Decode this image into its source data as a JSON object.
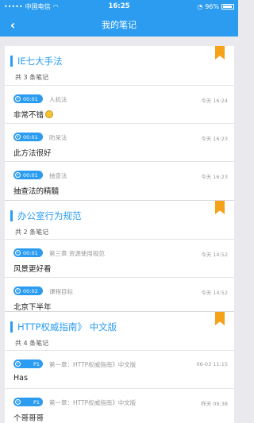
{
  "status": {
    "carrier": "中国电信",
    "time": "16:25",
    "battery": "96%"
  },
  "nav": {
    "back_icon": "chevron-left-icon",
    "title": "我的笔记"
  },
  "groups": [
    {
      "title": "IE七大手法",
      "count": "共 3 条笔记",
      "notes": [
        {
          "badge": "00:01",
          "source": "人机法",
          "time": "今天 16:24",
          "text": "非常不错"
        },
        {
          "badge": "00:01",
          "source": "防呆法",
          "time": "今天 16:23",
          "text": "此方法很好"
        },
        {
          "badge": "00:01",
          "source": "抽查法",
          "time": "今天 16:23",
          "text": "抽查法的精髓"
        }
      ]
    },
    {
      "title": "办公室行为规范",
      "count": "共 2 条笔记",
      "notes": [
        {
          "badge": "00:01",
          "source": "第三章 资源使用规范",
          "time": "今天 14:52",
          "text": "风景更好看"
        },
        {
          "badge": "00:02",
          "source": "课程目标",
          "time": "今天 14:52",
          "text": "北京下半年"
        }
      ]
    },
    {
      "title": "HTTP权威指南》 中文版",
      "count": "共 4 条笔记",
      "notes": [
        {
          "badge": "P1",
          "source": "第一章：HTTP权威指南》中文版",
          "time": "06-03 11:15",
          "text": "Has"
        },
        {
          "badge": "P1",
          "source": "第一章：HTTP权威指南》中文版",
          "time": "昨天 09:38",
          "text": "个哥哥哥"
        }
      ]
    }
  ]
}
